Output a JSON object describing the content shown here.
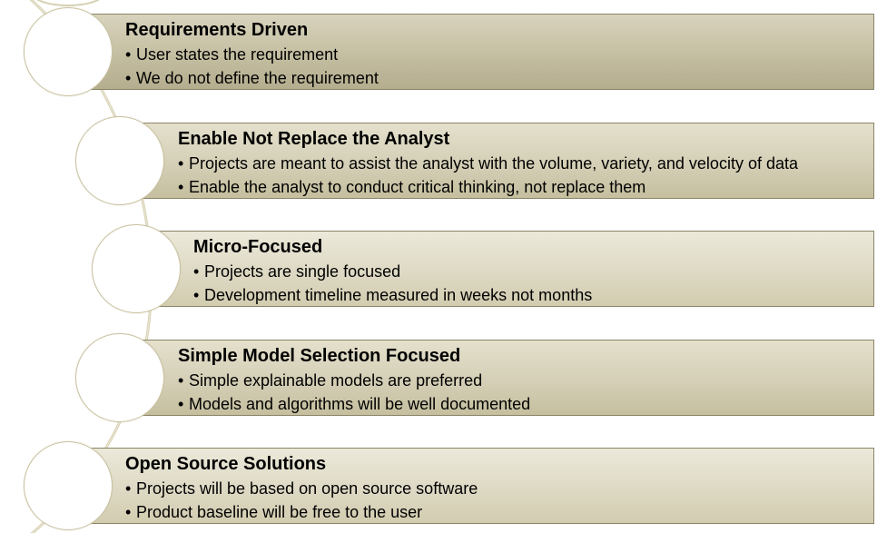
{
  "items": [
    {
      "title": "Requirements Driven",
      "bullets": [
        "User states the requirement",
        "We do not define the requirement"
      ]
    },
    {
      "title": "Enable Not Replace the Analyst",
      "bullets": [
        "Projects are meant to assist the analyst with the volume, variety, and velocity of data",
        "Enable the analyst to conduct critical thinking, not replace them"
      ]
    },
    {
      "title": "Micro-Focused",
      "bullets": [
        "Projects are single focused",
        "Development timeline measured in weeks not months"
      ]
    },
    {
      "title": "Simple Model Selection Focused",
      "bullets": [
        "Simple explainable models are preferred",
        "Models and algorithms will be well documented"
      ]
    },
    {
      "title": "Open Source Solutions",
      "bullets": [
        "Projects will be based on open source software",
        "Product baseline will be free to the user"
      ]
    }
  ],
  "colors": {
    "band_dark": "#c6c0a4",
    "band_border": "#8a8468",
    "node_border": "#c8c1a0",
    "curve": "#d7d1b4"
  },
  "bullet_glyph": "•"
}
